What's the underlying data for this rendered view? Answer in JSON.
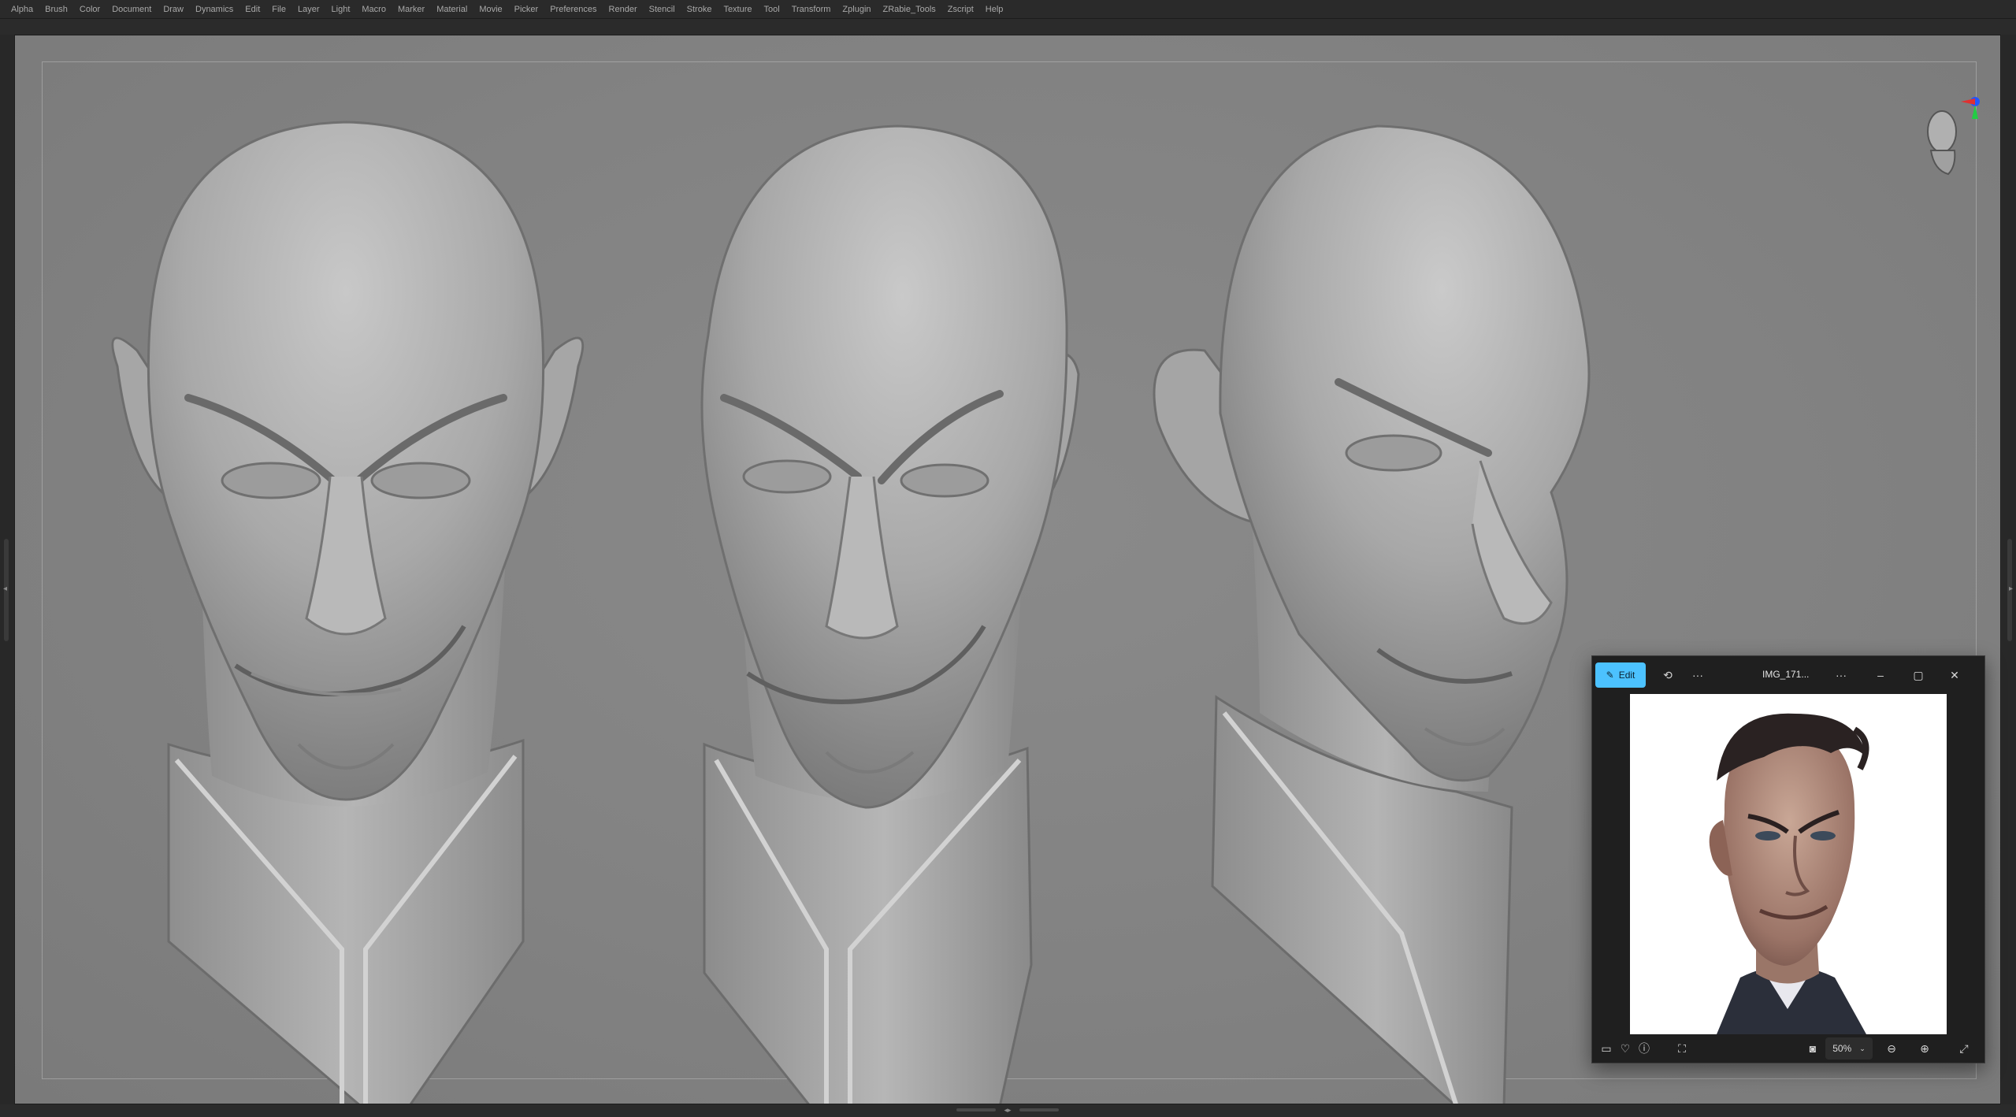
{
  "menu": {
    "items": [
      "Alpha",
      "Brush",
      "Color",
      "Document",
      "Draw",
      "Dynamics",
      "Edit",
      "File",
      "Layer",
      "Light",
      "Macro",
      "Marker",
      "Material",
      "Movie",
      "Picker",
      "Preferences",
      "Render",
      "Stencil",
      "Stroke",
      "Texture",
      "Tool",
      "Transform",
      "Zplugin",
      "ZRabie_Tools",
      "Zscript",
      "Help"
    ]
  },
  "viewport": {
    "background_color": "#858585",
    "models": [
      {
        "view": "front",
        "material": "gray clay"
      },
      {
        "view": "three-quarter",
        "material": "gray clay"
      },
      {
        "view": "side",
        "material": "gray clay"
      }
    ],
    "gizmo": {
      "axis_colors": {
        "x": "#e03030",
        "y": "#22cc44",
        "z": "#2255ff"
      },
      "icon": "head-gizmo-icon"
    }
  },
  "photo_viewer": {
    "edit_label": "Edit",
    "title": "IMG_171...",
    "zoom": "50%",
    "accent": "#4cc2ff",
    "icons": {
      "edit": "edit-pencil-icon",
      "rotate": "rotate-icon",
      "more_left": "more-icon",
      "more_right": "more-icon",
      "minimize": "minimize-icon",
      "maximize": "maximize-icon",
      "close": "close-icon",
      "filmstrip": "filmstrip-icon",
      "favorite": "heart-icon",
      "info": "info-icon",
      "fit": "fit-to-window-icon",
      "screenshot": "camera-icon",
      "zoom_out": "zoom-out-icon",
      "zoom_in": "zoom-in-icon",
      "fullscreen": "fullscreen-icon"
    }
  }
}
